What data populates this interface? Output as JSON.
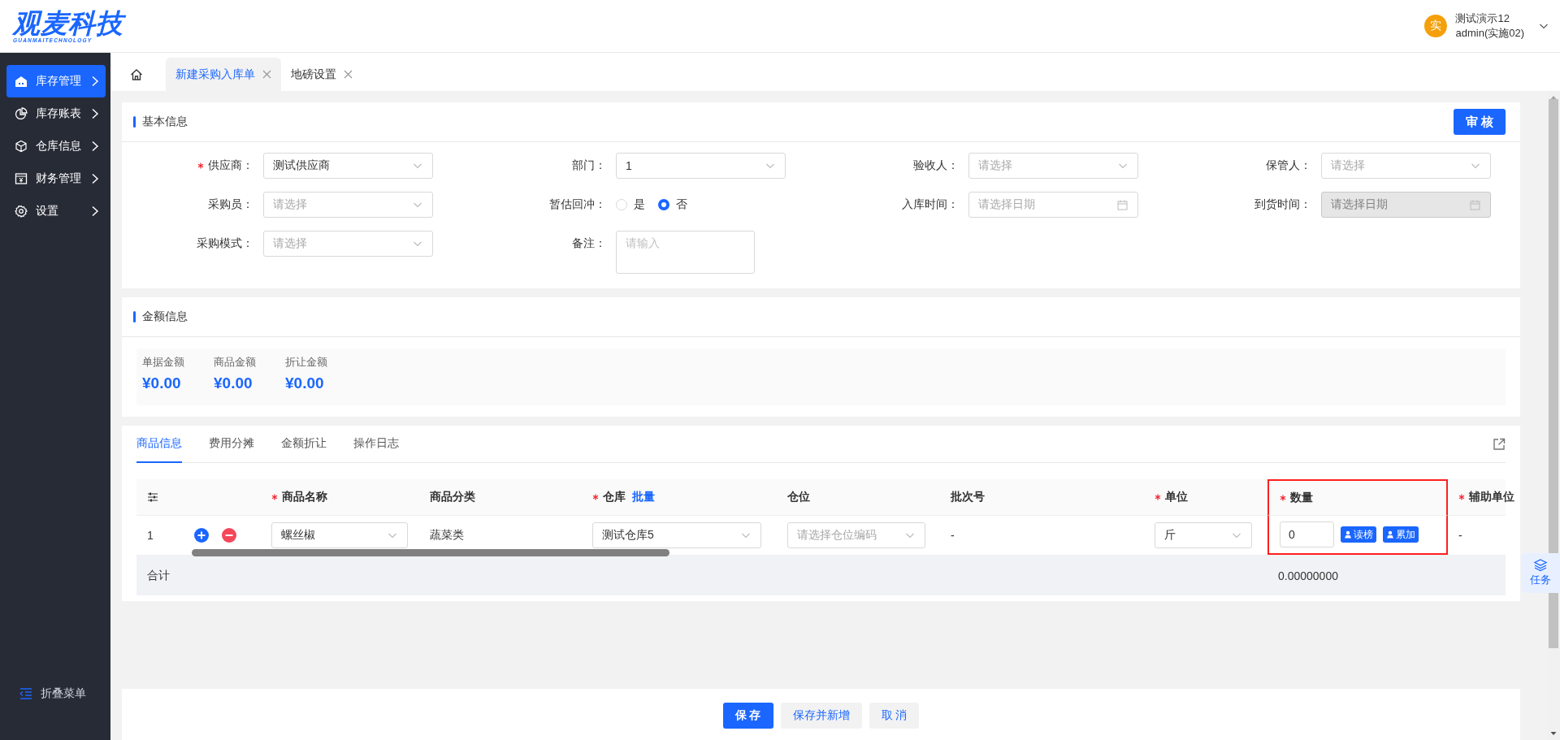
{
  "logo": {
    "title": "观麦科技",
    "subtitle": "GUANMAITECHNOLOGY"
  },
  "user": {
    "avatar": "实",
    "name": "测试演示12",
    "account": "admin(实施02)"
  },
  "sidebar": {
    "items": [
      {
        "label": "库存管理",
        "selected": true
      },
      {
        "label": "库存账表",
        "selected": false
      },
      {
        "label": "仓库信息",
        "selected": false
      },
      {
        "label": "财务管理",
        "selected": false
      },
      {
        "label": "设置",
        "selected": false
      }
    ],
    "collapse_label": "折叠菜单"
  },
  "tabs": [
    {
      "label": "新建采购入库单",
      "selected": true
    },
    {
      "label": "地磅设置",
      "selected": false
    }
  ],
  "basic_info": {
    "title": "基本信息",
    "action": "审 核",
    "fields": [
      {
        "label": "供应商：",
        "required": true,
        "kind": "select",
        "value": "测试供应商"
      },
      {
        "label": "部门：",
        "required": false,
        "kind": "select",
        "value": "1"
      },
      {
        "label": "验收人：",
        "required": false,
        "kind": "select",
        "placeholder": "请选择"
      },
      {
        "label": "保管人：",
        "required": false,
        "kind": "select",
        "placeholder": "请选择"
      },
      {
        "label": "采购员：",
        "required": false,
        "kind": "select",
        "placeholder": "请选择"
      },
      {
        "label": "暂估回冲：",
        "required": false,
        "kind": "radio",
        "options": [
          {
            "label": "是",
            "selected": false
          },
          {
            "label": "否",
            "selected": true
          }
        ]
      },
      {
        "label": "入库时间：",
        "required": false,
        "kind": "date",
        "placeholder": "请选择日期",
        "disabled": false
      },
      {
        "label": "到货时间：",
        "required": false,
        "kind": "date",
        "placeholder": "请选择日期",
        "disabled": true
      },
      {
        "label": "采购模式：",
        "required": false,
        "kind": "select",
        "placeholder": "请选择"
      },
      {
        "label": "备注：",
        "required": false,
        "kind": "textarea",
        "placeholder": "请输入"
      }
    ]
  },
  "amount_info": {
    "title": "金额信息",
    "items": [
      {
        "label": "单据金额",
        "value": "¥0.00"
      },
      {
        "label": "商品金额",
        "value": "¥0.00"
      },
      {
        "label": "折让金额",
        "value": "¥0.00"
      }
    ]
  },
  "goods": {
    "tabs": [
      {
        "label": "商品信息",
        "selected": true
      },
      {
        "label": "费用分摊",
        "selected": false
      },
      {
        "label": "金额折让",
        "selected": false
      },
      {
        "label": "操作日志",
        "selected": false
      }
    ],
    "table": {
      "columns": [
        {
          "kind": "settings",
          "highlighted": false
        },
        {
          "kind": "actions",
          "highlighted": false
        },
        {
          "kind": "text",
          "label": "商品名称",
          "required": true,
          "highlighted": false
        },
        {
          "kind": "text",
          "label": "商品分类",
          "required": false,
          "highlighted": false
        },
        {
          "kind": "text",
          "label": "仓库",
          "link": "批量",
          "required": true,
          "highlighted": false
        },
        {
          "kind": "text",
          "label": "仓位",
          "required": false,
          "highlighted": false
        },
        {
          "kind": "text",
          "label": "批次号",
          "required": false,
          "highlighted": false
        },
        {
          "kind": "text",
          "label": "单位",
          "required": true,
          "highlighted": false
        },
        {
          "kind": "text",
          "label": "数量",
          "required": true,
          "highlighted": true
        },
        {
          "kind": "text",
          "label": "辅助单位",
          "required": true,
          "highlighted": false
        }
      ],
      "rows": [
        {
          "cells": [
            {
              "kind": "text",
              "text": "1"
            },
            {
              "kind": "actions"
            },
            {
              "kind": "select",
              "value": "螺丝椒"
            },
            {
              "kind": "text",
              "text": "蔬菜类"
            },
            {
              "kind": "select",
              "value": "测试仓库5"
            },
            {
              "kind": "select",
              "placeholder": "请选择仓位编码"
            },
            {
              "kind": "text",
              "text": "-"
            },
            {
              "kind": "select",
              "value": "斤"
            },
            {
              "kind": "quantity",
              "value": "0",
              "buttons": [
                "读榜",
                "累加"
              ]
            },
            {
              "kind": "text",
              "text": "-"
            }
          ]
        }
      ],
      "total": {
        "label": "合计",
        "quantity": "0.00000000"
      }
    }
  },
  "task_button": {
    "label": "任务"
  },
  "footer": {
    "buttons": [
      {
        "label": "保 存",
        "primary": true
      },
      {
        "label": "保存并新增",
        "primary": false
      },
      {
        "label": "取 消",
        "primary": false
      }
    ]
  }
}
